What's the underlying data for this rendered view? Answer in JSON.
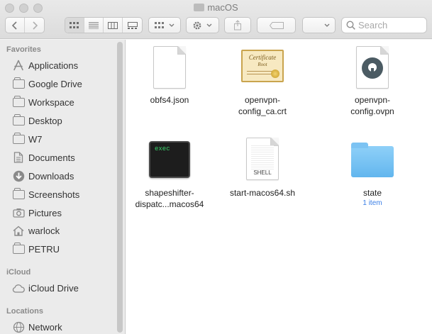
{
  "window": {
    "title": "macOS"
  },
  "toolbar": {
    "search_placeholder": "Search"
  },
  "sidebar": {
    "sections": {
      "favorites": "Favorites",
      "icloud": "iCloud",
      "locations": "Locations"
    },
    "favorites": [
      {
        "label": "Applications",
        "icon": "applications-icon"
      },
      {
        "label": "Google Drive",
        "icon": "folder-icon"
      },
      {
        "label": "Workspace",
        "icon": "folder-icon"
      },
      {
        "label": "Desktop",
        "icon": "folder-icon"
      },
      {
        "label": "W7",
        "icon": "folder-icon"
      },
      {
        "label": "Documents",
        "icon": "document-icon"
      },
      {
        "label": "Downloads",
        "icon": "download-icon"
      },
      {
        "label": "Screenshots",
        "icon": "folder-icon"
      },
      {
        "label": "Pictures",
        "icon": "camera-icon"
      },
      {
        "label": "warlock",
        "icon": "home-icon"
      },
      {
        "label": "PETRU",
        "icon": "folder-icon"
      }
    ],
    "icloud": [
      {
        "label": "iCloud Drive",
        "icon": "cloud-icon"
      }
    ],
    "locations": [
      {
        "label": "Network",
        "icon": "globe-icon"
      }
    ]
  },
  "files": [
    {
      "name_lines": [
        "obfs4.json"
      ],
      "type": "json-file"
    },
    {
      "name_lines": [
        "openvpn-",
        "config_ca.crt"
      ],
      "type": "certificate-file",
      "cert_text": "Certificate",
      "cert_sub": "Root"
    },
    {
      "name_lines": [
        "openvpn-",
        "config.ovpn"
      ],
      "type": "ovpn-file"
    },
    {
      "name_lines": [
        "shapeshifter-",
        "dispatc...macos64"
      ],
      "type": "exec-file",
      "badge": "exec"
    },
    {
      "name_lines": [
        "start-macos64.sh"
      ],
      "type": "shell-file",
      "badge": "SHELL"
    },
    {
      "name_lines": [
        "state"
      ],
      "type": "folder",
      "sub": "1 item"
    }
  ]
}
